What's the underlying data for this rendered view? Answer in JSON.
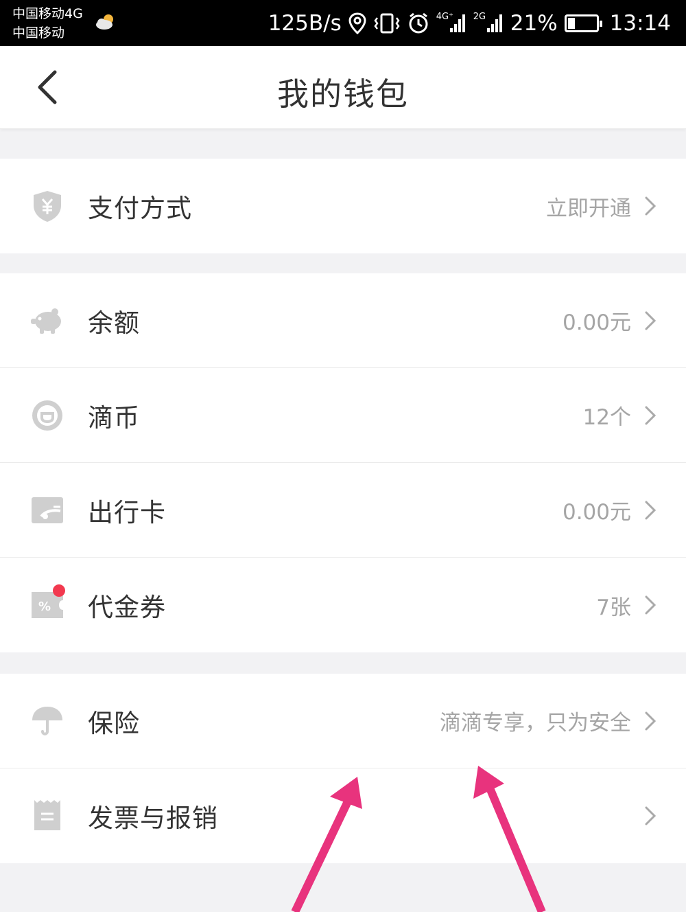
{
  "status_bar": {
    "carrier_1": "中国移动4G",
    "carrier_2": "中国移动",
    "net_speed": "125B/s",
    "battery": "21%",
    "time": "13:14",
    "sig1_label": "4G⁺",
    "sig2_label": "2G"
  },
  "header": {
    "title": "我的钱包"
  },
  "sections": [
    {
      "rows": [
        {
          "id": "payment",
          "icon": "shield-yuan-icon",
          "label": "支付方式",
          "value": "立即开通"
        }
      ]
    },
    {
      "rows": [
        {
          "id": "balance",
          "icon": "piggy-bank-icon",
          "label": "余额",
          "value": "0.00元"
        },
        {
          "id": "coins",
          "icon": "didi-coin-icon",
          "label": "滴币",
          "value": "12个"
        },
        {
          "id": "travel-card",
          "icon": "travel-card-icon",
          "label": "出行卡",
          "value": "0.00元"
        },
        {
          "id": "vouchers",
          "icon": "voucher-icon",
          "label": "代金券",
          "value": "7张",
          "badge": true
        }
      ]
    },
    {
      "rows": [
        {
          "id": "insurance",
          "icon": "umbrella-icon",
          "label": "保险",
          "value": "滴滴专享，只为安全"
        },
        {
          "id": "invoice",
          "icon": "receipt-icon",
          "label": "发票与报销",
          "value": ""
        }
      ]
    }
  ],
  "colors": {
    "icon_gray": "#cfcfcf",
    "badge_red": "#f2394f",
    "annotation_arrow": "#e8337d"
  }
}
